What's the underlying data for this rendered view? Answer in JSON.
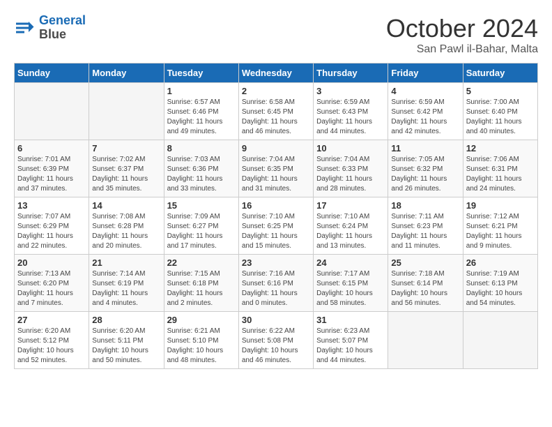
{
  "logo": {
    "line1": "General",
    "line2": "Blue"
  },
  "title": "October 2024",
  "subtitle": "San Pawl il-Bahar, Malta",
  "days_header": [
    "Sunday",
    "Monday",
    "Tuesday",
    "Wednesday",
    "Thursday",
    "Friday",
    "Saturday"
  ],
  "weeks": [
    [
      {
        "day": "",
        "info": ""
      },
      {
        "day": "",
        "info": ""
      },
      {
        "day": "1",
        "info": "Sunrise: 6:57 AM\nSunset: 6:46 PM\nDaylight: 11 hours and 49 minutes."
      },
      {
        "day": "2",
        "info": "Sunrise: 6:58 AM\nSunset: 6:45 PM\nDaylight: 11 hours and 46 minutes."
      },
      {
        "day": "3",
        "info": "Sunrise: 6:59 AM\nSunset: 6:43 PM\nDaylight: 11 hours and 44 minutes."
      },
      {
        "day": "4",
        "info": "Sunrise: 6:59 AM\nSunset: 6:42 PM\nDaylight: 11 hours and 42 minutes."
      },
      {
        "day": "5",
        "info": "Sunrise: 7:00 AM\nSunset: 6:40 PM\nDaylight: 11 hours and 40 minutes."
      }
    ],
    [
      {
        "day": "6",
        "info": "Sunrise: 7:01 AM\nSunset: 6:39 PM\nDaylight: 11 hours and 37 minutes."
      },
      {
        "day": "7",
        "info": "Sunrise: 7:02 AM\nSunset: 6:37 PM\nDaylight: 11 hours and 35 minutes."
      },
      {
        "day": "8",
        "info": "Sunrise: 7:03 AM\nSunset: 6:36 PM\nDaylight: 11 hours and 33 minutes."
      },
      {
        "day": "9",
        "info": "Sunrise: 7:04 AM\nSunset: 6:35 PM\nDaylight: 11 hours and 31 minutes."
      },
      {
        "day": "10",
        "info": "Sunrise: 7:04 AM\nSunset: 6:33 PM\nDaylight: 11 hours and 28 minutes."
      },
      {
        "day": "11",
        "info": "Sunrise: 7:05 AM\nSunset: 6:32 PM\nDaylight: 11 hours and 26 minutes."
      },
      {
        "day": "12",
        "info": "Sunrise: 7:06 AM\nSunset: 6:31 PM\nDaylight: 11 hours and 24 minutes."
      }
    ],
    [
      {
        "day": "13",
        "info": "Sunrise: 7:07 AM\nSunset: 6:29 PM\nDaylight: 11 hours and 22 minutes."
      },
      {
        "day": "14",
        "info": "Sunrise: 7:08 AM\nSunset: 6:28 PM\nDaylight: 11 hours and 20 minutes."
      },
      {
        "day": "15",
        "info": "Sunrise: 7:09 AM\nSunset: 6:27 PM\nDaylight: 11 hours and 17 minutes."
      },
      {
        "day": "16",
        "info": "Sunrise: 7:10 AM\nSunset: 6:25 PM\nDaylight: 11 hours and 15 minutes."
      },
      {
        "day": "17",
        "info": "Sunrise: 7:10 AM\nSunset: 6:24 PM\nDaylight: 11 hours and 13 minutes."
      },
      {
        "day": "18",
        "info": "Sunrise: 7:11 AM\nSunset: 6:23 PM\nDaylight: 11 hours and 11 minutes."
      },
      {
        "day": "19",
        "info": "Sunrise: 7:12 AM\nSunset: 6:21 PM\nDaylight: 11 hours and 9 minutes."
      }
    ],
    [
      {
        "day": "20",
        "info": "Sunrise: 7:13 AM\nSunset: 6:20 PM\nDaylight: 11 hours and 7 minutes."
      },
      {
        "day": "21",
        "info": "Sunrise: 7:14 AM\nSunset: 6:19 PM\nDaylight: 11 hours and 4 minutes."
      },
      {
        "day": "22",
        "info": "Sunrise: 7:15 AM\nSunset: 6:18 PM\nDaylight: 11 hours and 2 minutes."
      },
      {
        "day": "23",
        "info": "Sunrise: 7:16 AM\nSunset: 6:16 PM\nDaylight: 11 hours and 0 minutes."
      },
      {
        "day": "24",
        "info": "Sunrise: 7:17 AM\nSunset: 6:15 PM\nDaylight: 10 hours and 58 minutes."
      },
      {
        "day": "25",
        "info": "Sunrise: 7:18 AM\nSunset: 6:14 PM\nDaylight: 10 hours and 56 minutes."
      },
      {
        "day": "26",
        "info": "Sunrise: 7:19 AM\nSunset: 6:13 PM\nDaylight: 10 hours and 54 minutes."
      }
    ],
    [
      {
        "day": "27",
        "info": "Sunrise: 6:20 AM\nSunset: 5:12 PM\nDaylight: 10 hours and 52 minutes."
      },
      {
        "day": "28",
        "info": "Sunrise: 6:20 AM\nSunset: 5:11 PM\nDaylight: 10 hours and 50 minutes."
      },
      {
        "day": "29",
        "info": "Sunrise: 6:21 AM\nSunset: 5:10 PM\nDaylight: 10 hours and 48 minutes."
      },
      {
        "day": "30",
        "info": "Sunrise: 6:22 AM\nSunset: 5:08 PM\nDaylight: 10 hours and 46 minutes."
      },
      {
        "day": "31",
        "info": "Sunrise: 6:23 AM\nSunset: 5:07 PM\nDaylight: 10 hours and 44 minutes."
      },
      {
        "day": "",
        "info": ""
      },
      {
        "day": "",
        "info": ""
      }
    ]
  ]
}
